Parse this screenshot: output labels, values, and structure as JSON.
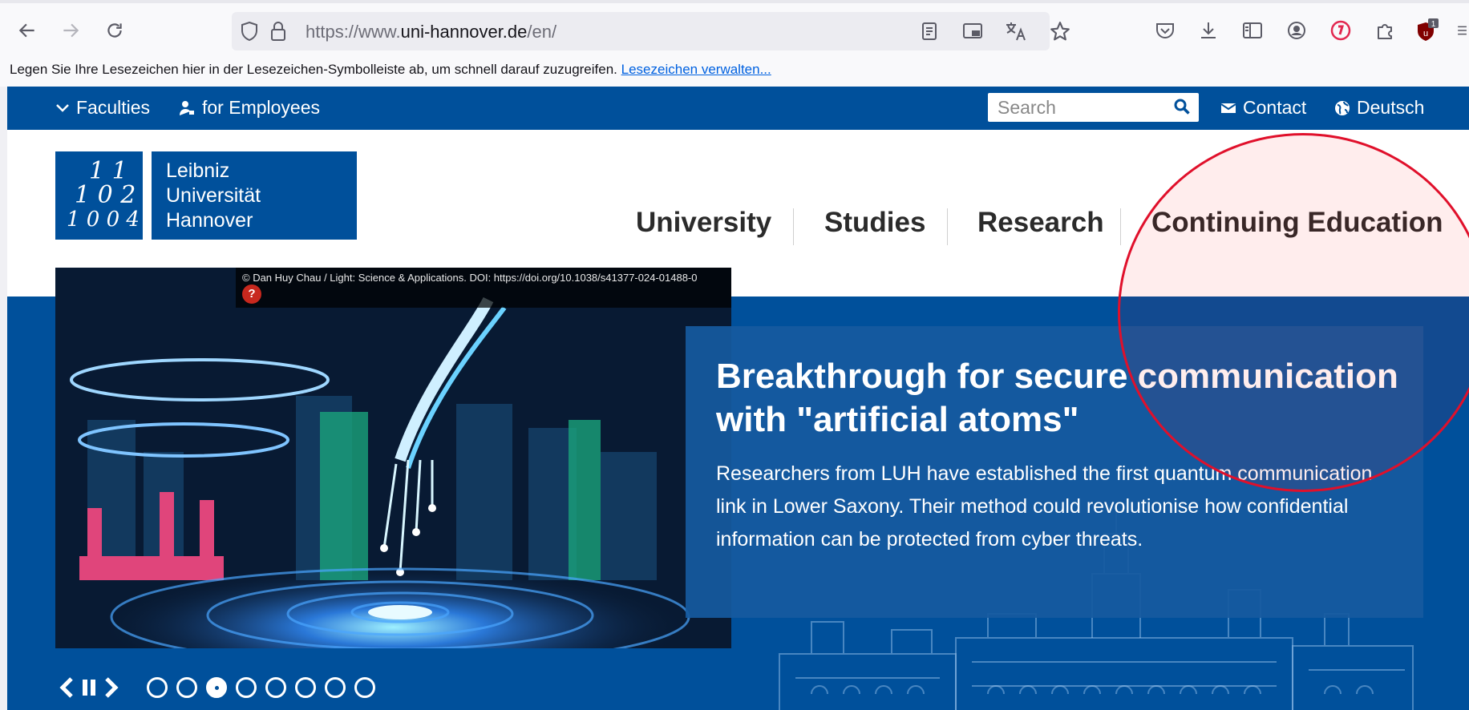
{
  "browser": {
    "url_prefix": "https://www.",
    "url_domain": "uni-hannover.de",
    "url_path": "/en/",
    "extension_badge": "1"
  },
  "bookmarks_bar": {
    "text": "Legen Sie Ihre Lesezeichen hier in der Lesezeichen-Symbolleiste ab, um schnell darauf zuzugreifen.",
    "link": "Lesezeichen verwalten..."
  },
  "topbar": {
    "faculties": "Faculties",
    "employees": "for Employees",
    "search_placeholder": "Search",
    "contact": "Contact",
    "language": "Deutsch"
  },
  "logo": {
    "mark_lines": [
      "1 1",
      "1 0 2",
      "1 0 0 4"
    ],
    "line1": "Leibniz",
    "line2": "Universität",
    "line3": "Hannover"
  },
  "main_nav": [
    "University",
    "Studies",
    "Research",
    "Continuing Education"
  ],
  "hero": {
    "credit": "© Dan Huy Chau / Light: Science & Applications. DOI: https://doi.org/10.1038/s41377-024-01488-0",
    "title": "Breakthrough for secure communication with \"artificial atoms\"",
    "text": "Researchers from LUH have established the first quantum communication link in Lower Saxony. Their method could revolutionise how confidential information can be protected from cyber threats.",
    "slides_total": 8,
    "active_slide": 3
  },
  "colors": {
    "brand_blue": "#00509b",
    "annotation_red": "#e0102b"
  }
}
